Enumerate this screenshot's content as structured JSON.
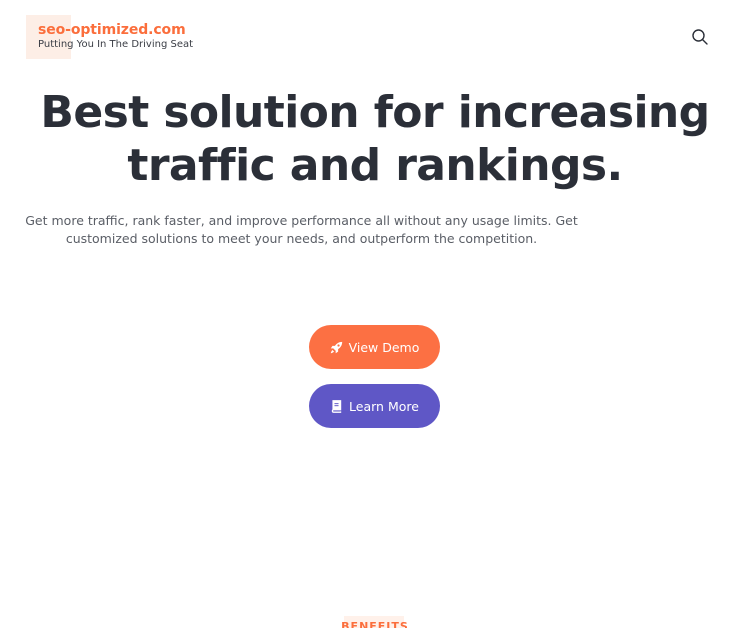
{
  "header": {
    "site_title": "seo-optimized.com",
    "tagline": "Putting You In The Driving Seat",
    "search_icon": "search-icon"
  },
  "hero": {
    "title": "Best solution for increasing traffic and rankings.",
    "subtitle": "Get more traffic, rank faster, and improve performance all without any usage limits. Get customized solutions to meet your needs, and outperform the competition."
  },
  "buttons": {
    "view_demo": {
      "label": "View Demo",
      "icon": "rocket-icon"
    },
    "learn_more": {
      "label": "Learn More",
      "icon": "book-icon"
    }
  },
  "benefits": {
    "label": "BENEFITS"
  },
  "colors": {
    "accent": "#fc7043",
    "secondary": "#5f57c6",
    "heading": "#2b2f38"
  }
}
